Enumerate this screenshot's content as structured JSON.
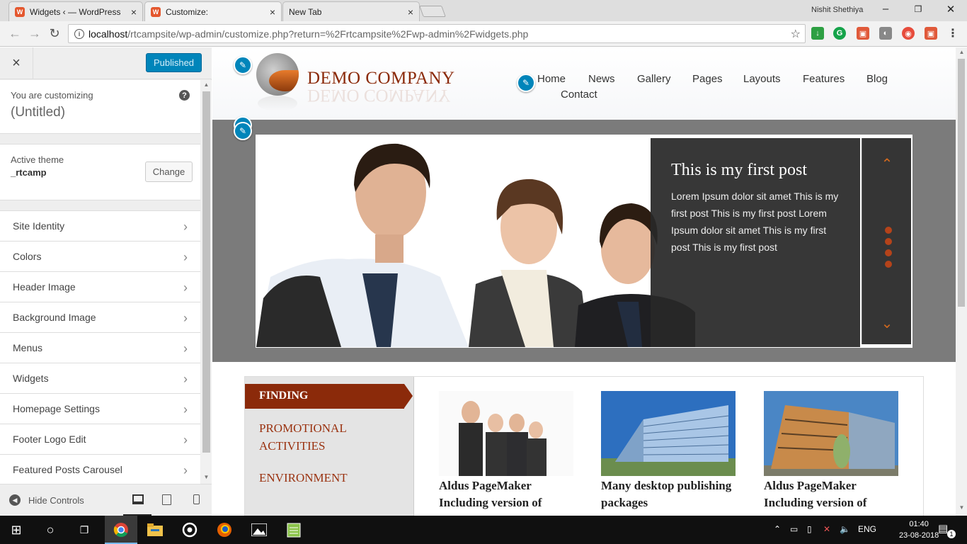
{
  "browser": {
    "tabs": [
      {
        "title": "Widgets ‹ — WordPress",
        "close": "×"
      },
      {
        "title": "Customize:",
        "close": "×"
      },
      {
        "title": "New Tab",
        "close": "×"
      }
    ],
    "user": "Nishit Shethiya",
    "window_controls": [
      "–",
      "❐",
      "✕"
    ],
    "url_host": "localhost",
    "url_path": "/rtcampsite/wp-admin/customize.php?return=%2Frtcampsite%2Fwp-admin%2Fwidgets.php"
  },
  "customizer": {
    "close_label": "×",
    "publish_label": "Published",
    "customizing_label": "You are customizing",
    "site_title": "(Untitled)",
    "help_label": "?",
    "active_theme_label": "Active theme",
    "theme_name": "_rtcamp",
    "change_label": "Change",
    "sections": [
      "Site Identity",
      "Colors",
      "Header Image",
      "Background Image",
      "Menus",
      "Widgets",
      "Homepage Settings",
      "Footer Logo Edit",
      "Featured Posts Carousel"
    ],
    "hide_controls_label": "Hide Controls"
  },
  "site": {
    "company_name": "DEMO COMPANY",
    "nav": [
      "Home",
      "News",
      "Gallery",
      "Pages",
      "Layouts",
      "Features",
      "Blog",
      "Contact"
    ],
    "slide": {
      "title": "This is my first post",
      "text": "Lorem Ipsum dolor sit amet This is my first post This is my first post Lorem Ipsum dolor sit amet This is my first post This is my first post"
    },
    "tabs": {
      "active": "FINDING",
      "items": [
        "PROMOTIONAL ACTIVITIES",
        "ENVIRONMENT"
      ]
    },
    "posts": [
      {
        "title": "Aldus PageMaker Including version of"
      },
      {
        "title": "Many desktop publishing packages"
      },
      {
        "title": "Aldus PageMaker Including version of"
      }
    ]
  },
  "taskbar": {
    "lang": "ENG",
    "time": "01:40",
    "date": "23-08-2018",
    "notifications": "1"
  },
  "colors": {
    "wp_blue": "#0085ba",
    "brand_red": "#8b2a0a",
    "accent_orange": "#d2691e"
  }
}
